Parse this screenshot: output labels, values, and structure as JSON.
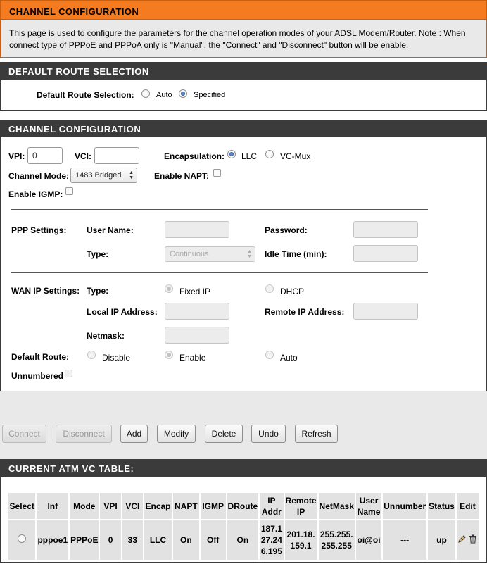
{
  "header": {
    "title": "CHANNEL CONFIGURATION",
    "description": "This page is used to configure the parameters for the channel operation modes of your ADSL Modem/Router. Note : When connect type of PPPoE and PPPoA only is \"Manual\", the \"Connect\" and \"Disconnect\" button will be enable."
  },
  "default_route": {
    "section_title": "DEFAULT ROUTE SELECTION",
    "label": "Default Route Selection:",
    "options": [
      "Auto",
      "Specified"
    ],
    "selected": "Specified"
  },
  "channel": {
    "section_title": "CHANNEL CONFIGURATION",
    "vpi_label": "VPI:",
    "vpi_value": "0",
    "vci_label": "VCI:",
    "vci_value": "",
    "encap_label": "Encapsulation:",
    "encap_options": [
      "LLC",
      "VC-Mux"
    ],
    "encap_selected": "LLC",
    "mode_label": "Channel Mode:",
    "mode_value": "1483 Bridged",
    "napt_label": "Enable NAPT:",
    "igmp_label": "Enable IGMP:"
  },
  "ppp": {
    "label": "PPP Settings:",
    "username_label": "User Name:",
    "password_label": "Password:",
    "type_label": "Type:",
    "type_value": "Continuous",
    "idle_label": "Idle Time (min):"
  },
  "wan": {
    "label": "WAN IP Settings:",
    "type_label": "Type:",
    "type_options": [
      "Fixed IP",
      "DHCP"
    ],
    "local_ip_label": "Local IP Address:",
    "remote_ip_label": "Remote IP Address:",
    "netmask_label": "Netmask:",
    "default_route_label": "Default Route:",
    "default_route_options": [
      "Disable",
      "Enable",
      "Auto"
    ],
    "unnumbered_label": "Unnumbered"
  },
  "buttons": {
    "connect": "Connect",
    "disconnect": "Disconnect",
    "add": "Add",
    "modify": "Modify",
    "delete": "Delete",
    "undo": "Undo",
    "refresh": "Refresh"
  },
  "atm_table": {
    "section_title": "CURRENT ATM VC TABLE:",
    "headers": [
      "Select",
      "Inf",
      "Mode",
      "VPI",
      "VCI",
      "Encap",
      "NAPT",
      "IGMP",
      "DRoute",
      "IP Addr",
      "Remote IP",
      "NetMask",
      "User Name",
      "Unnumber",
      "Status",
      "Edit"
    ],
    "rows": [
      {
        "inf": "pppoe1",
        "mode": "PPPoE",
        "vpi": "0",
        "vci": "33",
        "encap": "LLC",
        "napt": "On",
        "igmp": "Off",
        "droute": "On",
        "ip_addr": "187.127.246.195",
        "remote_ip": "201.18.159.1",
        "netmask": "255.255.255.255",
        "user_name": "oi@oi",
        "unnumber": "---",
        "status": "up"
      }
    ]
  },
  "icons": {
    "edit": "pencil-icon",
    "delete": "trash-icon"
  },
  "colors": {
    "accent": "#f47b20",
    "section_header": "#3b3b3b",
    "panel_bg": "#e9e9e9",
    "radio_selected": "#5b86c1"
  }
}
